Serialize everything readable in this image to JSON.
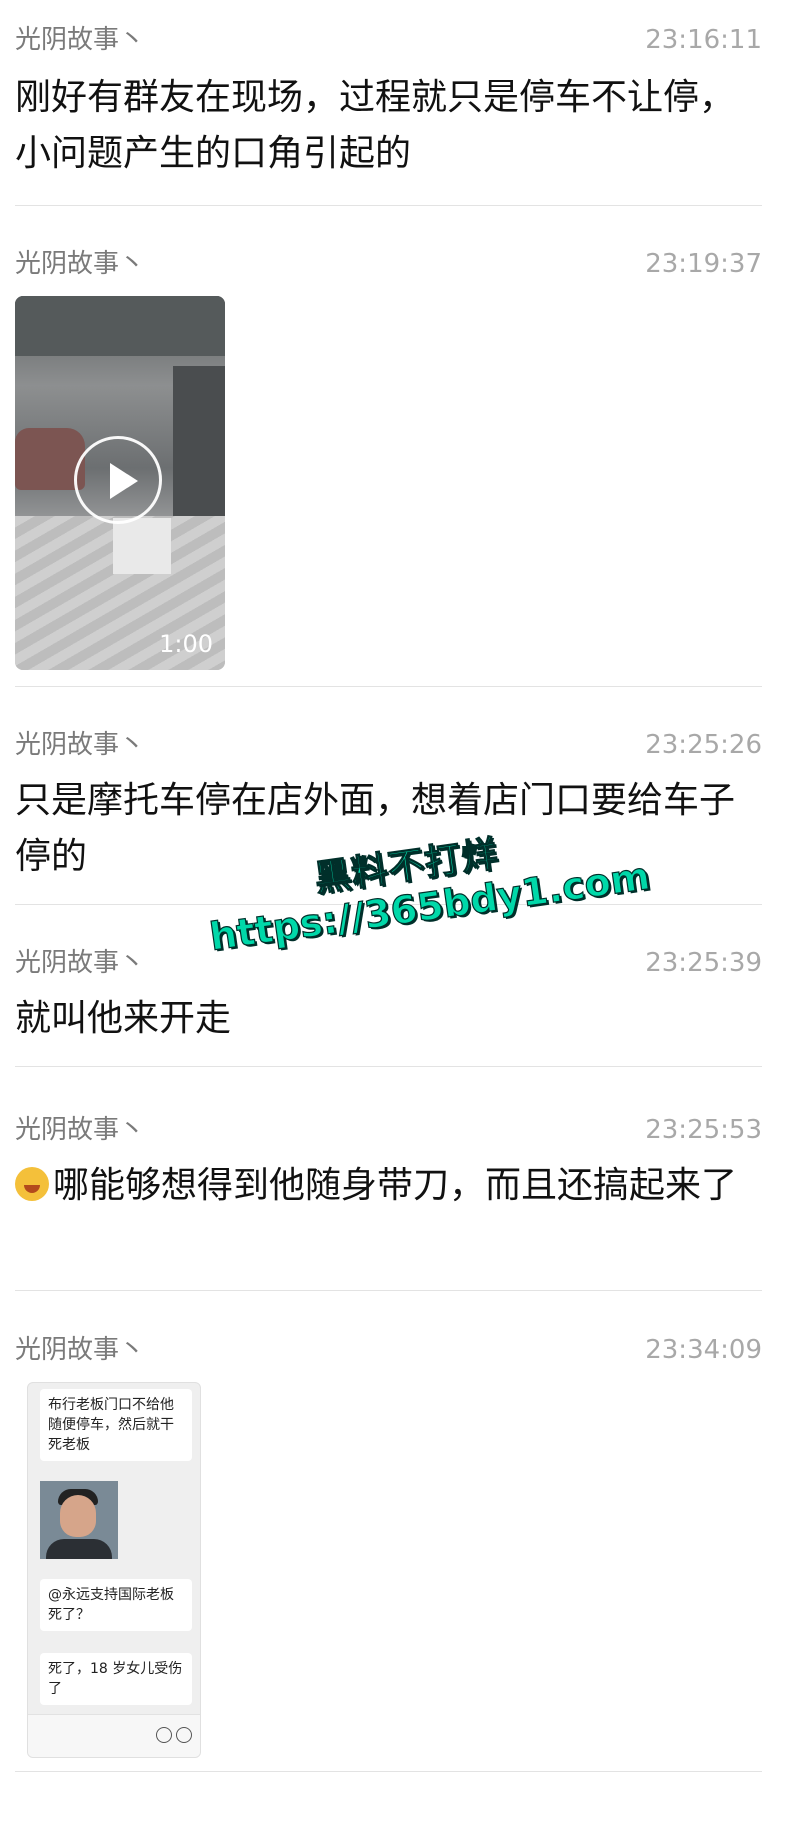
{
  "messages": [
    {
      "sender": "光阴故事丶",
      "time": "23:16:11",
      "text": "刚好有群友在现场，过程就只是停车不让停，小问题产生的口角引起的"
    },
    {
      "sender": "光阴故事丶",
      "time": "23:19:37",
      "video": {
        "duration": "1:00"
      }
    },
    {
      "sender": "光阴故事丶",
      "time": "23:25:26",
      "text": "只是摩托车停在店外面，想着店门口要给车子停的"
    },
    {
      "sender": "光阴故事丶",
      "time": "23:25:39",
      "text": "就叫他来开走"
    },
    {
      "sender": "光阴故事丶",
      "time": "23:25:53",
      "emoji": "sad-emoji",
      "text": "哪能够想得到他随身带刀，而且还搞起来了"
    },
    {
      "sender": "光阴故事丶",
      "time": "23:34:09",
      "screenshot": {
        "bubble1": "布行老板门口不给他随便停车，然后就干死老板",
        "bubble2": "@永远支持国际老板死了？",
        "bubble3": "死了，18 岁女儿受伤了"
      }
    }
  ],
  "watermark": {
    "line1": "黑料不打烊",
    "line2": "https://365bdy1.com"
  }
}
